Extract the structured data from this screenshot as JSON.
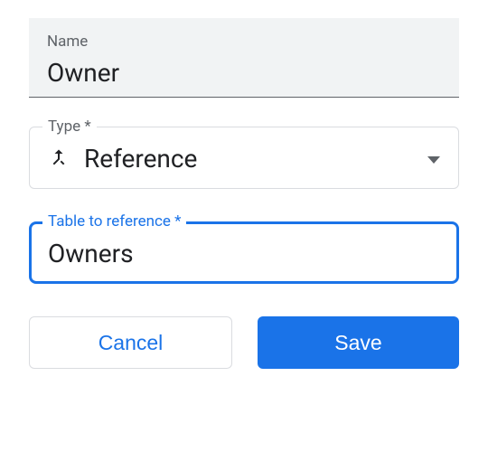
{
  "name_field": {
    "label": "Name",
    "value": "Owner"
  },
  "type_field": {
    "label": "Type *",
    "value": "Reference"
  },
  "reference_field": {
    "label": "Table to reference *",
    "value": "Owners"
  },
  "buttons": {
    "cancel": "Cancel",
    "save": "Save"
  }
}
